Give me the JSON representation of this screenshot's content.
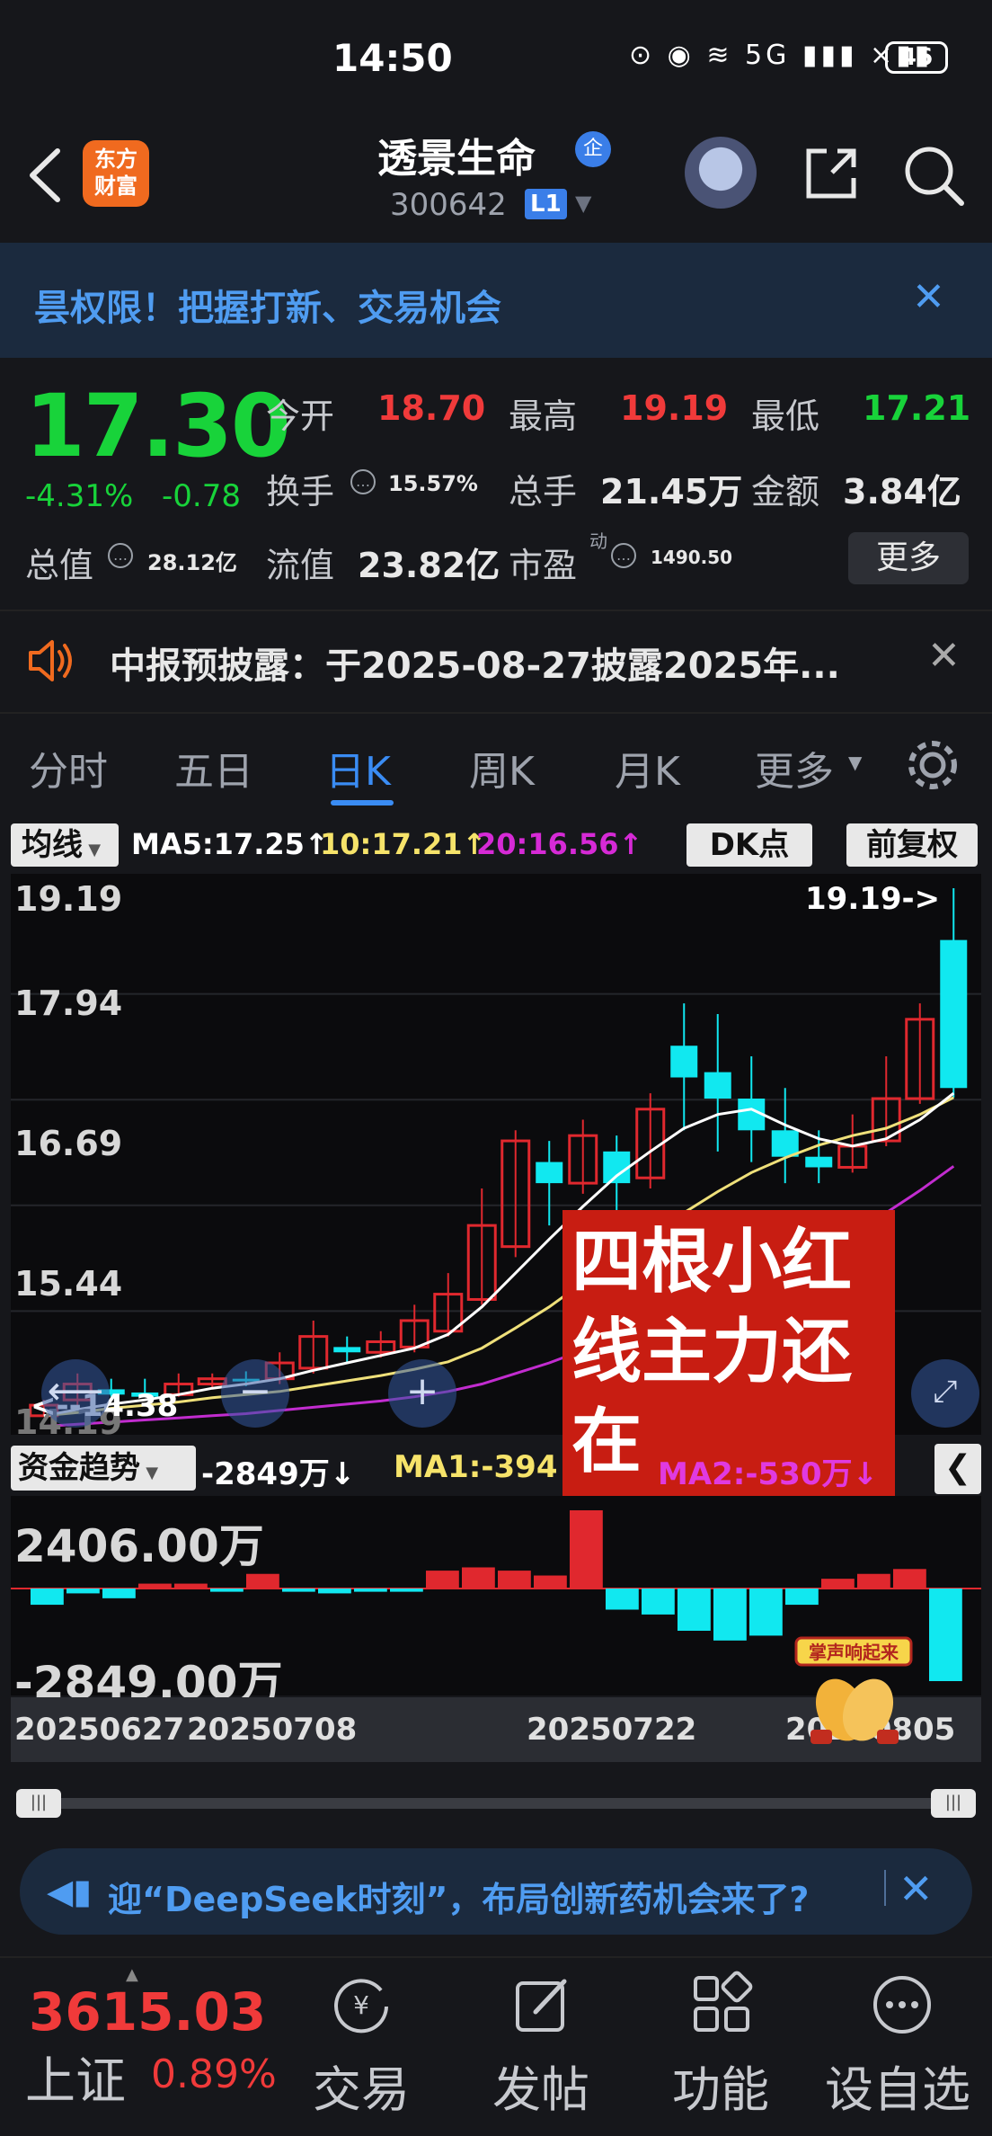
{
  "status": {
    "time": "14:50",
    "icons": "⊙ ◉ ≋ 5G ▮▮▮ ×▮▮",
    "battery": "46"
  },
  "header": {
    "logo_line1": "东方",
    "logo_line2": "财富",
    "title": "透景生命",
    "qi": "企",
    "code": "300642",
    "level": "L1"
  },
  "banner": {
    "text": "昙权限！把握打新、交易机会"
  },
  "quote": {
    "price": "17.30",
    "pct": "-4.31%",
    "chg": "-0.78",
    "open_label": "今开",
    "open": "18.70",
    "high_label": "最高",
    "high": "19.19",
    "low_label": "最低",
    "low": "17.21",
    "turnover_label": "换手",
    "turnover": "15.57%",
    "volume_label": "总手",
    "volume": "21.45万",
    "amount_label": "金额",
    "amount": "3.84亿",
    "mktcap_label": "总值",
    "mktcap": "28.12亿",
    "float_label": "流值",
    "float": "23.82亿",
    "pe_label": "市盈",
    "pe_sup": "动",
    "pe": "1490.50",
    "more": "更多"
  },
  "notice": {
    "text": "中报预披露：于2025-08-27披露2025年..."
  },
  "tabs": [
    "分时",
    "五日",
    "日K",
    "周K",
    "月K",
    "更多"
  ],
  "ma": {
    "dropdown": "均线",
    "ma5": "MA5:17.25↑",
    "ma10": "10:17.21↑",
    "ma20": "20:16.56↑",
    "dk": "DK点",
    "fuquan": "前复权"
  },
  "chart_data": [
    {
      "type": "candlestick",
      "y_ticks": [
        "19.19",
        "17.94",
        "16.69",
        "15.44",
        "14.19"
      ],
      "ylim": [
        14.19,
        19.19
      ],
      "high_label": "19.19->",
      "low_label": "<--14.38",
      "candles": [
        {
          "o": 14.2,
          "c": 14.3,
          "h": 14.35,
          "l": 14.19
        },
        {
          "o": 14.35,
          "c": 14.5,
          "h": 14.6,
          "l": 14.3
        },
        {
          "o": 14.45,
          "c": 14.4,
          "h": 14.55,
          "l": 14.38
        },
        {
          "o": 14.42,
          "c": 14.38,
          "h": 14.55,
          "l": 14.38
        },
        {
          "o": 14.4,
          "c": 14.5,
          "h": 14.6,
          "l": 14.38
        },
        {
          "o": 14.5,
          "c": 14.55,
          "h": 14.6,
          "l": 14.45
        },
        {
          "o": 14.55,
          "c": 14.53,
          "h": 14.62,
          "l": 14.48
        },
        {
          "o": 14.55,
          "c": 14.7,
          "h": 14.8,
          "l": 14.5
        },
        {
          "o": 14.65,
          "c": 14.95,
          "h": 15.1,
          "l": 14.6
        },
        {
          "o": 14.85,
          "c": 14.8,
          "h": 14.95,
          "l": 14.7
        },
        {
          "o": 14.8,
          "c": 14.9,
          "h": 15.0,
          "l": 14.75
        },
        {
          "o": 14.85,
          "c": 15.1,
          "h": 15.25,
          "l": 14.8
        },
        {
          "o": 15.0,
          "c": 15.35,
          "h": 15.55,
          "l": 14.95
        },
        {
          "o": 15.3,
          "c": 16.0,
          "h": 16.35,
          "l": 15.25
        },
        {
          "o": 15.8,
          "c": 16.8,
          "h": 16.9,
          "l": 15.7
        },
        {
          "o": 16.6,
          "c": 16.4,
          "h": 16.8,
          "l": 16.0
        },
        {
          "o": 16.4,
          "c": 16.85,
          "h": 17.0,
          "l": 16.3
        },
        {
          "o": 16.7,
          "c": 16.4,
          "h": 16.85,
          "l": 16.0
        },
        {
          "o": 16.45,
          "c": 17.1,
          "h": 17.25,
          "l": 16.35
        },
        {
          "o": 17.7,
          "c": 17.4,
          "h": 18.1,
          "l": 16.9
        },
        {
          "o": 17.45,
          "c": 17.2,
          "h": 18.0,
          "l": 16.7
        },
        {
          "o": 17.2,
          "c": 16.9,
          "h": 17.6,
          "l": 16.6
        },
        {
          "o": 16.9,
          "c": 16.65,
          "h": 17.3,
          "l": 16.4
        },
        {
          "o": 16.65,
          "c": 16.55,
          "h": 16.9,
          "l": 16.4
        },
        {
          "o": 16.55,
          "c": 16.75,
          "h": 17.05,
          "l": 16.5
        },
        {
          "o": 16.8,
          "c": 17.2,
          "h": 17.6,
          "l": 16.75
        },
        {
          "o": 17.2,
          "c": 17.95,
          "h": 18.1,
          "l": 17.15
        },
        {
          "o": 18.7,
          "c": 17.3,
          "h": 19.19,
          "l": 17.21
        }
      ],
      "ma5": [
        14.2,
        14.26,
        14.31,
        14.35,
        14.4,
        14.46,
        14.5,
        14.55,
        14.63,
        14.7,
        14.77,
        14.84,
        14.97,
        15.23,
        15.55,
        15.87,
        16.18,
        16.47,
        16.7,
        16.92,
        17.05,
        17.1,
        16.95,
        16.82,
        16.75,
        16.82,
        17.0,
        17.25
      ],
      "ma10": [
        14.2,
        14.23,
        14.27,
        14.3,
        14.33,
        14.37,
        14.4,
        14.43,
        14.48,
        14.53,
        14.58,
        14.64,
        14.71,
        14.84,
        15.03,
        15.23,
        15.46,
        15.68,
        15.9,
        16.12,
        16.32,
        16.5,
        16.64,
        16.76,
        16.85,
        16.92,
        17.05,
        17.21
      ],
      "ma20": [
        14.1,
        14.12,
        14.14,
        14.16,
        14.18,
        14.2,
        14.22,
        14.25,
        14.28,
        14.31,
        14.34,
        14.38,
        14.43,
        14.5,
        14.6,
        14.7,
        14.82,
        14.95,
        15.08,
        15.22,
        15.36,
        15.52,
        15.67,
        15.82,
        15.97,
        16.12,
        16.33,
        16.56
      ]
    },
    {
      "type": "bar",
      "title": "资金趋势",
      "ylim": [
        -2849,
        2406
      ],
      "y_ticks": [
        "2406.00万",
        "-2849.00万"
      ],
      "values": [
        -500,
        -150,
        -300,
        150,
        150,
        -100,
        450,
        -100,
        -150,
        -100,
        -100,
        550,
        650,
        550,
        400,
        2406,
        -650,
        -800,
        -1300,
        -1600,
        -1450,
        -500,
        300,
        450,
        600,
        -2849
      ],
      "x_ticks": [
        "20250627",
        "20250708",
        "20250722",
        "20250805"
      ]
    }
  ],
  "overlay": {
    "text": "四根小红线主力还在"
  },
  "money_flow": {
    "dropdown": "资金趋势",
    "value": "-2849万↓",
    "ma1": "MA1:-394",
    "ma2": "MA2:-530万↓"
  },
  "sticker": {
    "text": "掌声响起来"
  },
  "promo": {
    "text": "迎“DeepSeek时刻”，布局创新药机会来了?"
  },
  "bottom": {
    "index_value": "3615.03",
    "index_name": "上证",
    "index_pct": "0.89%",
    "nav": [
      "交易",
      "发帖",
      "功能",
      "设自选"
    ]
  },
  "colors": {
    "up": "#e0282e",
    "down": "#11e8f0",
    "price_green": "#18d33a",
    "accent": "#3a8cf4"
  }
}
